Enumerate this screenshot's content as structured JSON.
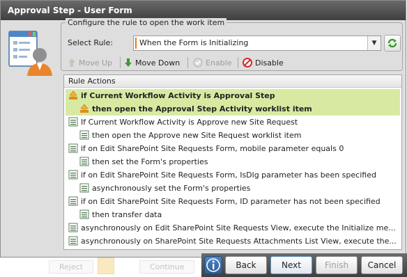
{
  "background": {
    "reject_label": "Reject",
    "continue_label": "Continue"
  },
  "dialog": {
    "title": "Approval Step - User Form",
    "group_legend": "Configure the rule to open the work item",
    "select_label": "Select Rule:",
    "selected_rule": "When the Form is Initializing"
  },
  "toolbar": {
    "move_up": "Move Up",
    "move_down": "Move Down",
    "enable": "Enable",
    "disable": "Disable"
  },
  "rules": {
    "header": "Rule Actions",
    "items": [
      {
        "text": "if Current Workflow Activity is Approval Step",
        "indent": 0,
        "selected": true,
        "icon": "approval-icon"
      },
      {
        "text": "then open the Approval Step Activity worklist item",
        "indent": 1,
        "selected": true,
        "icon": "approval-icon"
      },
      {
        "text": "If Current Workflow Activity is Approve new Site Request",
        "indent": 0,
        "selected": false,
        "icon": "list-icon"
      },
      {
        "text": "then open the Approve new Site Request worklist item",
        "indent": 1,
        "selected": false,
        "icon": "list-icon"
      },
      {
        "text": "if on Edit SharePoint Site Requests Form, mobile parameter equals 0",
        "indent": 0,
        "selected": false,
        "icon": "list-icon"
      },
      {
        "text": "then set the Form's properties",
        "indent": 1,
        "selected": false,
        "icon": "list-icon"
      },
      {
        "text": "if on Edit SharePoint Site Requests Form, IsDlg parameter has been specified",
        "indent": 0,
        "selected": false,
        "icon": "list-icon"
      },
      {
        "text": "asynchronously set the Form's properties",
        "indent": 1,
        "selected": false,
        "icon": "list-icon"
      },
      {
        "text": "if on Edit SharePoint Site Requests Form, ID parameter has not been specified",
        "indent": 0,
        "selected": false,
        "icon": "list-icon"
      },
      {
        "text": "then transfer data",
        "indent": 1,
        "selected": false,
        "icon": "list-icon"
      },
      {
        "text": "asynchronously on Edit SharePoint Site Requests View, execute the Initialize me...",
        "indent": 0,
        "selected": false,
        "icon": "list-icon"
      },
      {
        "text": "asynchronously on SharePoint Site Requests Attachments List View, execute the...",
        "indent": 0,
        "selected": false,
        "icon": "list-icon"
      }
    ]
  },
  "buttons": {
    "back": "Back",
    "next": "Next",
    "finish": "Finish",
    "cancel": "Cancel"
  },
  "colors": {
    "selection": "#d8eaa2",
    "titlebar": "#4a4a4a",
    "accent": "#e07b1f"
  }
}
